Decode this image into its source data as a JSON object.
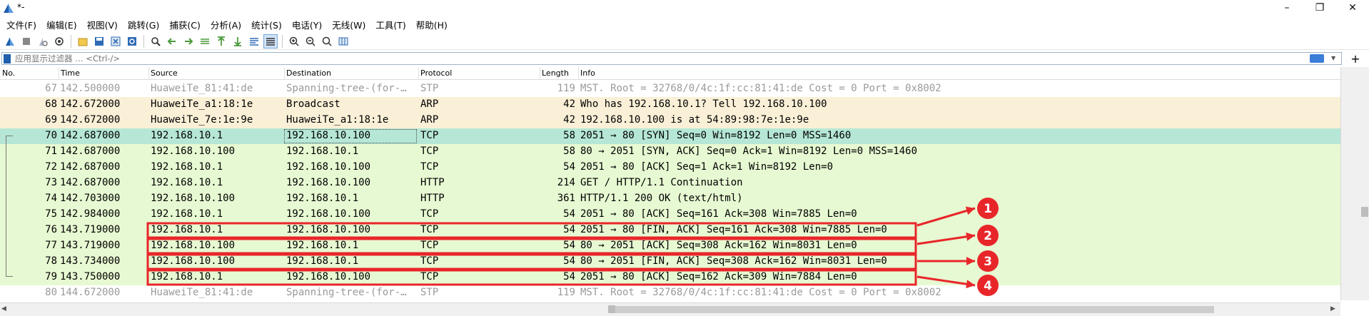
{
  "window": {
    "title": "*-",
    "minimize": "–",
    "restore": "❐",
    "close": "✕"
  },
  "menu": [
    "文件(F)",
    "编辑(E)",
    "视图(V)",
    "跳转(G)",
    "捕获(C)",
    "分析(A)",
    "统计(S)",
    "电话(Y)",
    "无线(W)",
    "工具(T)",
    "帮助(H)"
  ],
  "filter": {
    "placeholder": "应用显示过滤器 … <Ctrl-/>",
    "add": "+"
  },
  "columns": [
    "No.",
    "Time",
    "Source",
    "Destination",
    "Protocol",
    "Length",
    "Info"
  ],
  "colors": {
    "stp_bg": "#ffffff",
    "stp_fg": "#9a9a9a",
    "arp_bg": "#faf0d7",
    "tcp_bg": "#e7f9d2",
    "selected_bg": "#b6e7d6",
    "annotation": "#e8262a"
  },
  "packets": [
    {
      "no": "67",
      "time": "142.500000",
      "src": "HuaweiTe_81:41:de",
      "dst": "Spanning-tree-(for-…",
      "proto": "STP",
      "len": "119",
      "info": "MST. Root = 32768/0/4c:1f:cc:81:41:de  Cost = 0  Port = 0x8002",
      "kind": "stp"
    },
    {
      "no": "68",
      "time": "142.672000",
      "src": "HuaweiTe_a1:18:1e",
      "dst": "Broadcast",
      "proto": "ARP",
      "len": "42",
      "info": "Who has 192.168.10.1? Tell 192.168.10.100",
      "kind": "arp"
    },
    {
      "no": "69",
      "time": "142.672000",
      "src": "HuaweiTe_7e:1e:9e",
      "dst": "HuaweiTe_a1:18:1e",
      "proto": "ARP",
      "len": "42",
      "info": "192.168.10.100 is at 54:89:98:7e:1e:9e",
      "kind": "arp"
    },
    {
      "no": "70",
      "time": "142.687000",
      "src": "192.168.10.1",
      "dst": "192.168.10.100",
      "proto": "TCP",
      "len": "58",
      "info": "2051 → 80 [SYN] Seq=0 Win=8192 Len=0 MSS=1460",
      "kind": "selected"
    },
    {
      "no": "71",
      "time": "142.687000",
      "src": "192.168.10.100",
      "dst": "192.168.10.1",
      "proto": "TCP",
      "len": "58",
      "info": "80 → 2051 [SYN, ACK] Seq=0 Ack=1 Win=8192 Len=0 MSS=1460",
      "kind": "tcp"
    },
    {
      "no": "72",
      "time": "142.687000",
      "src": "192.168.10.1",
      "dst": "192.168.10.100",
      "proto": "TCP",
      "len": "54",
      "info": "2051 → 80 [ACK] Seq=1 Ack=1 Win=8192 Len=0",
      "kind": "tcp"
    },
    {
      "no": "73",
      "time": "142.687000",
      "src": "192.168.10.1",
      "dst": "192.168.10.100",
      "proto": "HTTP",
      "len": "214",
      "info": "GET / HTTP/1.1 Continuation",
      "kind": "tcp"
    },
    {
      "no": "74",
      "time": "142.703000",
      "src": "192.168.10.100",
      "dst": "192.168.10.1",
      "proto": "HTTP",
      "len": "361",
      "info": "HTTP/1.1 200 OK  (text/html)",
      "kind": "tcp"
    },
    {
      "no": "75",
      "time": "142.984000",
      "src": "192.168.10.1",
      "dst": "192.168.10.100",
      "proto": "TCP",
      "len": "54",
      "info": "2051 → 80 [ACK] Seq=161 Ack=308 Win=7885 Len=0",
      "kind": "tcp"
    },
    {
      "no": "76",
      "time": "143.719000",
      "src": "192.168.10.1",
      "dst": "192.168.10.100",
      "proto": "TCP",
      "len": "54",
      "info": "2051 → 80 [FIN, ACK] Seq=161 Ack=308 Win=7885 Len=0",
      "kind": "tcp"
    },
    {
      "no": "77",
      "time": "143.719000",
      "src": "192.168.10.100",
      "dst": "192.168.10.1",
      "proto": "TCP",
      "len": "54",
      "info": "80 → 2051 [ACK] Seq=308 Ack=162 Win=8031 Len=0",
      "kind": "tcp"
    },
    {
      "no": "78",
      "time": "143.734000",
      "src": "192.168.10.100",
      "dst": "192.168.10.1",
      "proto": "TCP",
      "len": "54",
      "info": "80 → 2051 [FIN, ACK] Seq=308 Ack=162 Win=8031 Len=0",
      "kind": "tcp"
    },
    {
      "no": "79",
      "time": "143.750000",
      "src": "192.168.10.1",
      "dst": "192.168.10.100",
      "proto": "TCP",
      "len": "54",
      "info": "2051 → 80 [ACK] Seq=162 Ack=309 Win=7884 Len=0",
      "kind": "tcp"
    },
    {
      "no": "80",
      "time": "144.672000",
      "src": "HuaweiTe_81:41:de",
      "dst": "Spanning-tree-(for-…",
      "proto": "STP",
      "len": "119",
      "info": "MST. Root = 32768/0/4c:1f:cc:81:41:de  Cost = 0  Port = 0x8002",
      "kind": "stp"
    }
  ],
  "annotations": [
    "1",
    "2",
    "3",
    "4"
  ]
}
